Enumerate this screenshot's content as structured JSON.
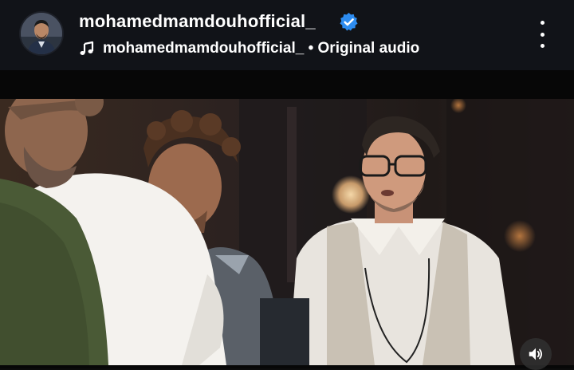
{
  "post_header": {
    "username": "mohamedmamdouhofficial_",
    "verified": true,
    "audio_label": "mohamedmamdouhofficial_ • Original audio"
  },
  "icons": {
    "verified": "verified-badge-icon",
    "audio": "music-note-icon",
    "menu": "more-vertical-icon",
    "volume": "volume-on-icon"
  },
  "colors": {
    "header_background": "#111318",
    "verified_badge": "#2d8cf0",
    "text": "#ffffff"
  },
  "video": {
    "scene": "movie-still"
  }
}
